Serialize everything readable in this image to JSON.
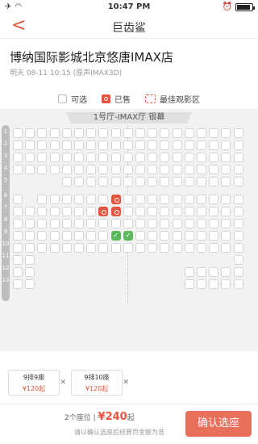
{
  "status": {
    "time": "10:47 PM"
  },
  "nav": {
    "back": "<",
    "title": "巨齿鲨"
  },
  "cinema": {
    "name": "博纳国际影城北京悠唐IMAX店",
    "showtime": "明天 08-11 10:15 (原声IMAX3D)"
  },
  "legend": {
    "available": "可选",
    "sold": "已售",
    "best": "最佳观影区"
  },
  "screen_label": "1号厅-IMAX厅 银幕",
  "row_labels": [
    "1",
    "2",
    "3",
    "4",
    "5",
    "6",
    "7",
    "8",
    "9",
    "10",
    "11",
    "12",
    "13"
  ],
  "tickets": [
    {
      "seat": "9排9座",
      "price": "¥120起"
    },
    {
      "seat": "9排10座",
      "price": "¥120起"
    }
  ],
  "summary": {
    "count": "2个座位",
    "separator": "|",
    "total": "¥240",
    "suffix": "起"
  },
  "note": "请以确认选座后结算页金额为准",
  "confirm": "确认选座",
  "colors": {
    "accent": "#e8543f",
    "selected": "#5cb85c"
  }
}
